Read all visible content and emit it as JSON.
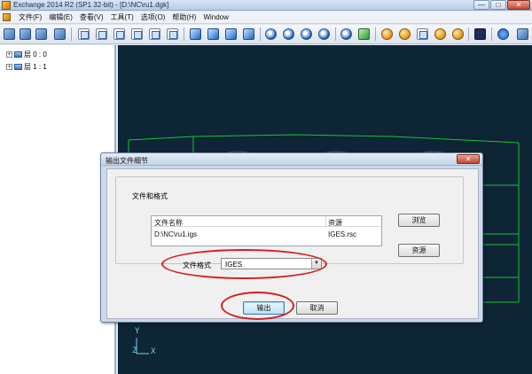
{
  "window": {
    "title": "Exchange 2014 R2 (SP1 32-bit) - [D:\\NC\\ru1.dgk]",
    "minimize_label": "—",
    "maximize_label": "□",
    "close_label": "✕"
  },
  "menubar": {
    "items": [
      "文件(F)",
      "编辑(E)",
      "查看(V)",
      "工具(T)",
      "选项(O)",
      "帮助(H)",
      "Window"
    ]
  },
  "tree": {
    "items": [
      {
        "label": "层 0 : 0"
      },
      {
        "label": "层 1 : 1"
      }
    ]
  },
  "viewport": {
    "axis_y": "Y",
    "axis_z": "Z",
    "axis_x": "X"
  },
  "dialog": {
    "title": "输出文件细节",
    "close_label": "✕",
    "group_label": "文件和格式",
    "list": {
      "columns": [
        "文件名称",
        "资源"
      ],
      "rows": [
        {
          "file": "D:\\NC\\ru1.igs",
          "resource": "IGES.rsc"
        }
      ]
    },
    "browse_button": "浏览",
    "resource_button": "资源",
    "format_label": "文件格式",
    "format_value": "IGES",
    "output_button": "输出",
    "cancel_button": "取消"
  }
}
